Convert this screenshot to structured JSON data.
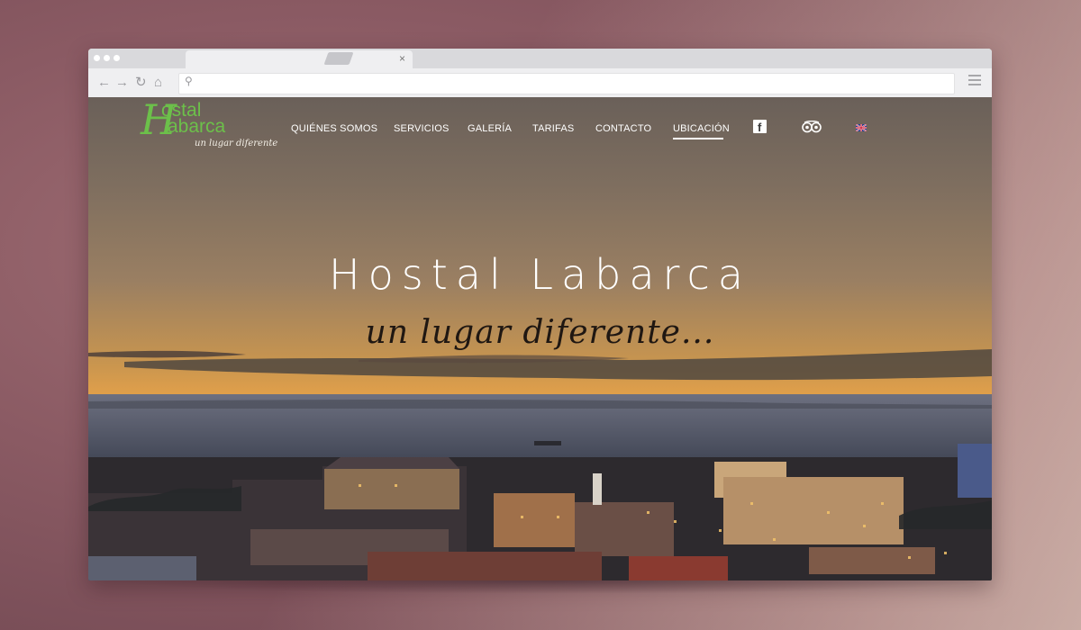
{
  "browser": {
    "tab_close": "×",
    "nav_back": "←",
    "nav_forward": "→",
    "nav_reload": "↻",
    "nav_home": "⌂",
    "search_glyph": "⚲"
  },
  "site": {
    "logo": {
      "line1": "ostal",
      "line2": "abarca",
      "initial": "H",
      "tagline": "un lugar diferente"
    },
    "nav": [
      {
        "label": "QUIÉNES SOMOS"
      },
      {
        "label": "SERVICIOS"
      },
      {
        "label": "GALERÍA"
      },
      {
        "label": "TARIFAS"
      },
      {
        "label": "CONTACTO"
      },
      {
        "label": "UBICACIÓN",
        "active": true
      }
    ],
    "social": {
      "facebook_glyph": "f",
      "icons": [
        "facebook-icon",
        "tripadvisor-icon",
        "uk-flag-icon"
      ]
    },
    "hero": {
      "title": "Hostal Labarca",
      "subtitle": "un lugar diferente..."
    }
  },
  "colors": {
    "logo_green": "#6cc04a",
    "nav_text": "#ffffff",
    "hero_subtitle": "#1f1712"
  }
}
